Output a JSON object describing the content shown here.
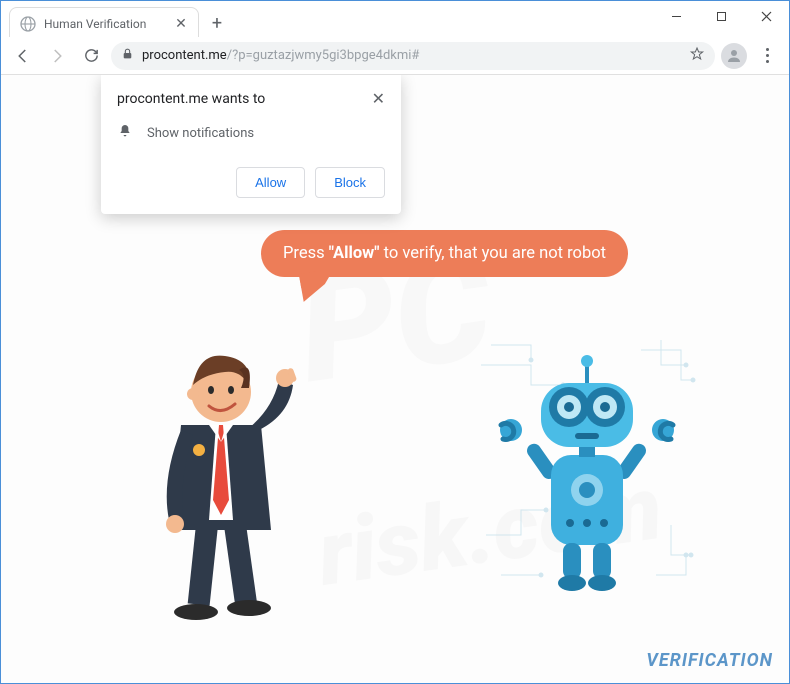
{
  "window": {
    "tab_title": "Human Verification",
    "address_domain": "procontent.me",
    "address_path": "/?p=guztazjwmy5gi3bpge4dkmi#"
  },
  "permission": {
    "title": "procontent.me wants to",
    "item": "Show notifications",
    "allow_label": "Allow",
    "block_label": "Block"
  },
  "page": {
    "speech_prefix": "Press ",
    "speech_bold": "\"Allow\"",
    "speech_suffix": " to verify, that you are not robot",
    "footer_label": "VERIFICATION"
  },
  "watermark": {
    "line1": "PC",
    "line2": "risk.com"
  }
}
